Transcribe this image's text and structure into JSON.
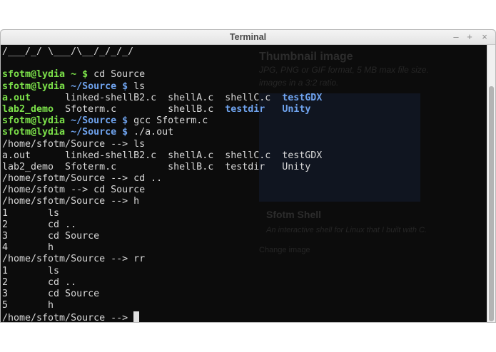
{
  "window": {
    "title": "Terminal",
    "controls": {
      "minimize": "–",
      "maximize": "+",
      "close": "×"
    }
  },
  "background_ghost": {
    "heading": "Thumbnail image",
    "text1": "JPG, PNG or GIF format, 5 MB max file size.",
    "text2": "images in a 3:2 ratio.",
    "card_title": "Sfotm Shell",
    "card_text": "An interactive shell for Linux that I built with C.",
    "link": "Change image"
  },
  "terminal": {
    "lines": [
      [
        {
          "text": "/___/_/ \\___/\\__/_/_/_/",
          "style": "plain"
        }
      ],
      [
        {
          "text": "",
          "style": "plain"
        }
      ],
      [
        {
          "text": "sfotm@lydia ~ $ ",
          "style": "grn"
        },
        {
          "text": "cd Source",
          "style": "plain"
        }
      ],
      [
        {
          "text": "sfotm@lydia ",
          "style": "grn"
        },
        {
          "text": "~/Source $ ",
          "style": "blu"
        },
        {
          "text": "ls",
          "style": "plain"
        }
      ],
      [
        {
          "text": "a.out",
          "style": "grn"
        },
        {
          "text": "      linked-shellB2.c  shellA.c  shellC.c  ",
          "style": "plain"
        },
        {
          "text": "testGDX",
          "style": "blu"
        }
      ],
      [
        {
          "text": "lab2_demo",
          "style": "grn"
        },
        {
          "text": "  Sfoterm.c         shellB.c  ",
          "style": "plain"
        },
        {
          "text": "testdir",
          "style": "blu"
        },
        {
          "text": "   ",
          "style": "plain"
        },
        {
          "text": "Unity",
          "style": "blu"
        }
      ],
      [
        {
          "text": "sfotm@lydia ",
          "style": "grn"
        },
        {
          "text": "~/Source $ ",
          "style": "blu"
        },
        {
          "text": "gcc Sfoterm.c",
          "style": "plain"
        }
      ],
      [
        {
          "text": "sfotm@lydia ",
          "style": "grn"
        },
        {
          "text": "~/Source $ ",
          "style": "blu"
        },
        {
          "text": "./a.out",
          "style": "plain"
        }
      ],
      [
        {
          "text": "/home/sfotm/Source --> ls",
          "style": "plain"
        }
      ],
      [
        {
          "text": "a.out      linked-shellB2.c  shellA.c  shellC.c  testGDX",
          "style": "plain"
        }
      ],
      [
        {
          "text": "lab2_demo  Sfoterm.c         shellB.c  testdir   Unity",
          "style": "plain"
        }
      ],
      [
        {
          "text": "/home/sfotm/Source --> cd ..",
          "style": "plain"
        }
      ],
      [
        {
          "text": "/home/sfotm --> cd Source",
          "style": "plain"
        }
      ],
      [
        {
          "text": "/home/sfotm/Source --> h",
          "style": "plain"
        }
      ],
      [
        {
          "text": "1       ls",
          "style": "plain"
        }
      ],
      [
        {
          "text": "2       cd ..",
          "style": "plain"
        }
      ],
      [
        {
          "text": "3       cd Source",
          "style": "plain"
        }
      ],
      [
        {
          "text": "4       h",
          "style": "plain"
        }
      ],
      [
        {
          "text": "/home/sfotm/Source --> rr",
          "style": "plain"
        }
      ],
      [
        {
          "text": "1       ls",
          "style": "plain"
        }
      ],
      [
        {
          "text": "2       cd ..",
          "style": "plain"
        }
      ],
      [
        {
          "text": "3       cd Source",
          "style": "plain"
        }
      ],
      [
        {
          "text": "5       h",
          "style": "plain"
        }
      ],
      [
        {
          "text": "/home/sfotm/Source --> ",
          "style": "plain"
        }
      ]
    ]
  }
}
